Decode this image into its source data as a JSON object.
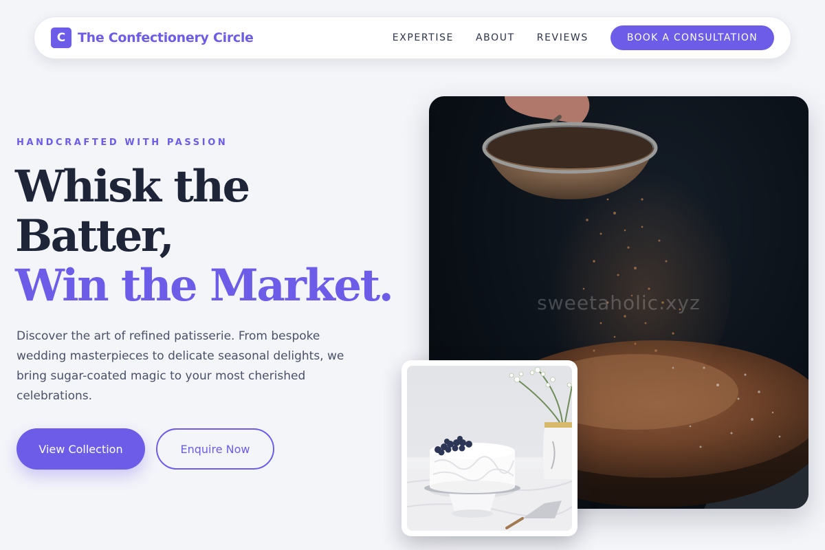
{
  "nav": {
    "brand_mark": "C",
    "brand_name": "The Confectionery Circle",
    "links": [
      "EXPERTISE",
      "ABOUT",
      "REVIEWS"
    ],
    "cta": "BOOK A CONSULTATION"
  },
  "hero": {
    "eyebrow": "HANDCRAFTED WITH PASSION",
    "headline_line1": "Whisk the",
    "headline_line2": "Batter,",
    "headline_accent": "Win the Market.",
    "description": "Discover the art of refined patisserie. From bespoke wedding masterpieces to delicate seasonal delights, we bring sugar-coated magic to your most cherished celebrations.",
    "primary_button": "View Collection",
    "secondary_button": "Enquire Now"
  },
  "images": {
    "main_watermark": "sweetaholic.xyz"
  },
  "colors": {
    "accent": "#6c5ce7",
    "heading": "#1e2538",
    "background": "#f4f5f9"
  }
}
